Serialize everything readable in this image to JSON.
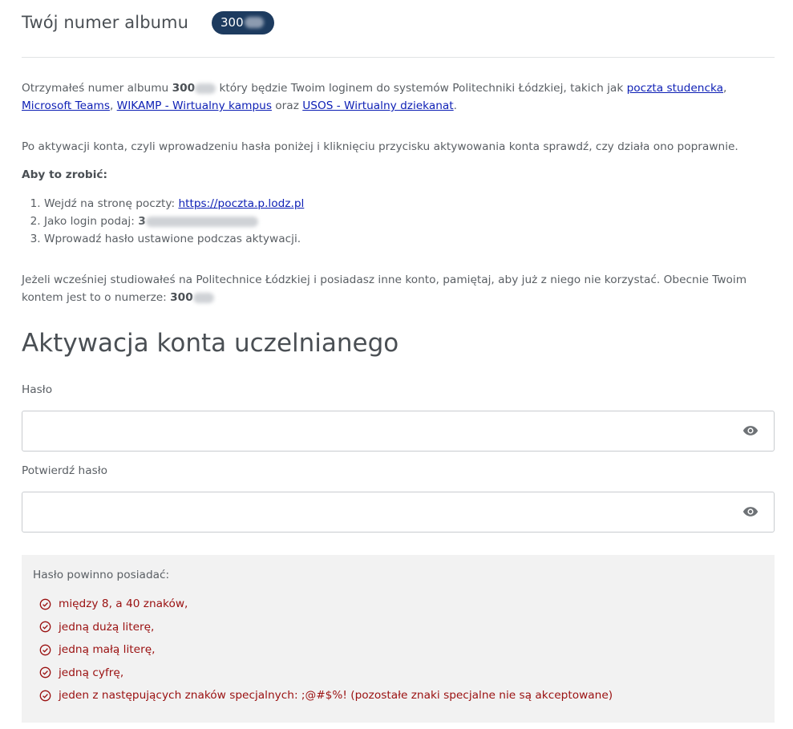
{
  "header": {
    "title": "Twój numer albumu",
    "album_number_badge": "300"
  },
  "intro": {
    "part1": "Otrzymałeś numer albumu ",
    "album_number": "300",
    "part2": " który będzie Twoim loginem do systemów Politechniki Łódzkiej, takich jak ",
    "link_mail": "poczta studencka",
    "sep1": ",",
    "link_teams": "Microsoft Teams",
    "sep2": ", ",
    "link_wikamp": "WIKAMP - Wirtualny kampus",
    "sep3": " oraz ",
    "link_usos": "USOS - Wirtualny dziekanat",
    "end": "."
  },
  "check_info": "Po aktywacji konta, czyli wprowadzeniu hasła poniżej i kliknięciu przycisku aktywowania konta sprawdź, czy działa ono poprawnie.",
  "how_to_title": "Aby to zrobić:",
  "steps": {
    "step1_text": "Wejdź na stronę poczty: ",
    "step1_link": "https://poczta.p.lodz.pl",
    "step2_text": "Jako login podaj: ",
    "step2_value": "3",
    "step3_text": "Wprowadź hasło ustawione podczas aktywacji."
  },
  "previous_account": {
    "text": "Jeżeli wcześniej studiowałeś na Politechnice Łódzkiej i posiadasz inne konto, pamiętaj, aby już z niego nie korzystać. Obecnie Twoim kontem jest to o numerze: ",
    "number": "300"
  },
  "activation": {
    "title": "Aktywacja konta uczelnianego",
    "password_label": "Hasło",
    "confirm_label": "Potwierdź hasło",
    "password_value": "",
    "confirm_value": ""
  },
  "requirements": {
    "title": "Hasło powinno posiadać:",
    "items": [
      "między 8, a 40 znaków,",
      "jedną dużą literę,",
      "jedną małą literę,",
      "jedną cyfrę,",
      "jeden z następujących znaków specjalnych: ;@#$%! (pozostałe znaki specjalne nie są akceptowane)"
    ],
    "item_color": "#9a1010"
  },
  "colors": {
    "badge_bg": "#1d3b5f",
    "link": "#0d1fb5",
    "requirements_bg": "#f2f2f2"
  }
}
